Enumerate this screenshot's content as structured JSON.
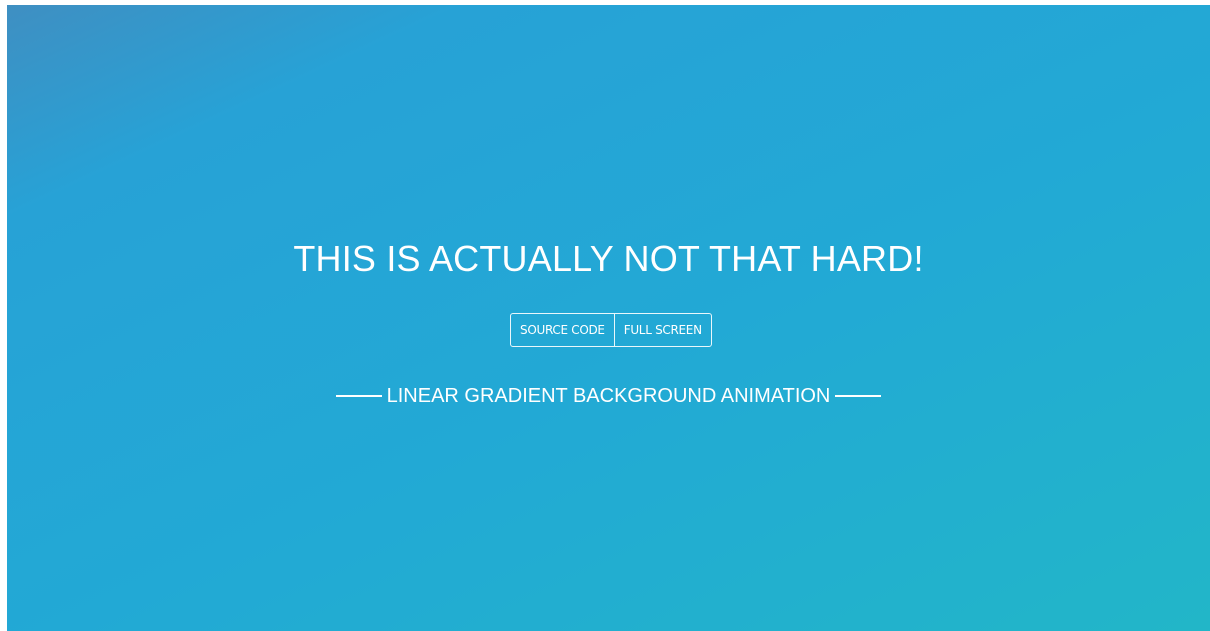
{
  "hero": {
    "headline": "THIS IS ACTUALLY NOT THAT HARD!",
    "subtitle": "LINEAR GRADIENT BACKGROUND ANIMATION"
  },
  "buttons": {
    "source_code": "SOURCE CODE",
    "full_screen": "FULL SCREEN"
  },
  "colors": {
    "gradient_top_left": "#3f8fc2",
    "gradient_mid": "#22a9d5",
    "gradient_bottom_right": "#22b6c8",
    "text": "#ffffff"
  }
}
